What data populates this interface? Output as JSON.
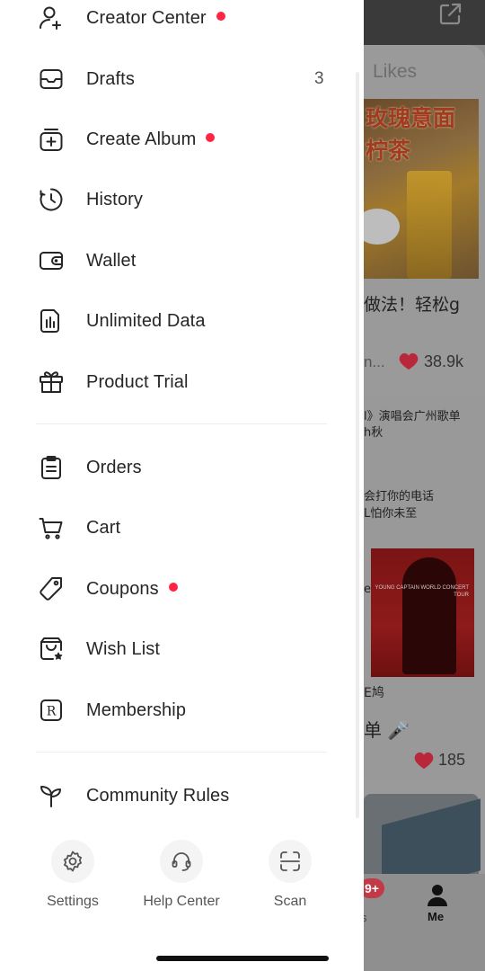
{
  "background": {
    "tab_label": "Likes",
    "card1": {
      "image_text_line1": "玫瑰意面",
      "image_text_line2": "柠茶",
      "description": "做法！轻松g",
      "user": "n...",
      "likes": "38.9k"
    },
    "card2": {
      "line1": "l》演唱会广州歌单",
      "line2": "h秋",
      "line3": "会打你的电话",
      "line4": "L怕你未至",
      "side_char": "e)",
      "poster_text": "YOUNG CAPTAIN WORLD CONCERT TOUR",
      "caption_small": "E鸠",
      "caption_big": "单 🎤",
      "likes": "185"
    },
    "tabbar": {
      "badge": "9+",
      "partial_label": "s",
      "me_label": "Me"
    },
    "colors": {
      "like_heart": "#b8283a",
      "badge": "#c23a46"
    }
  },
  "drawer": {
    "menu_items": [
      {
        "label": "Creator Center",
        "icon": "creator-icon",
        "dot": true
      },
      {
        "label": "Drafts",
        "icon": "drafts-icon",
        "count": "3"
      },
      {
        "label": "Create Album",
        "icon": "create-album-icon",
        "dot": true
      },
      {
        "label": "History",
        "icon": "history-icon"
      },
      {
        "label": "Wallet",
        "icon": "wallet-icon"
      },
      {
        "label": "Unlimited Data",
        "icon": "unlimited-data-icon"
      },
      {
        "label": "Product Trial",
        "icon": "gift-icon"
      },
      {
        "label": "Orders",
        "icon": "orders-icon"
      },
      {
        "label": "Cart",
        "icon": "cart-icon"
      },
      {
        "label": "Coupons",
        "icon": "coupon-icon",
        "dot": true
      },
      {
        "label": "Wish List",
        "icon": "wish-list-icon"
      },
      {
        "label": "Membership",
        "icon": "membership-icon"
      },
      {
        "label": "Community Rules",
        "icon": "sprout-icon"
      }
    ],
    "bottom_buttons": [
      {
        "label": "Settings",
        "icon": "gear-icon"
      },
      {
        "label": "Help Center",
        "icon": "headset-icon"
      },
      {
        "label": "Scan",
        "icon": "scan-icon"
      }
    ],
    "colors": {
      "dot": "#ff2442",
      "text": "#262626"
    }
  }
}
